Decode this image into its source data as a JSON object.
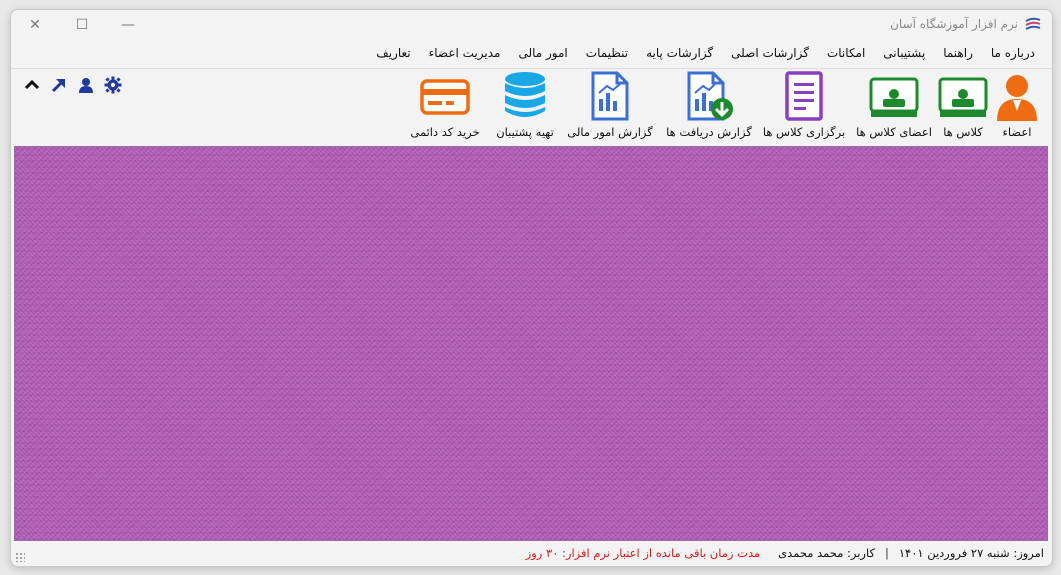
{
  "window": {
    "title": "نرم افزار آموزشگاه آسان",
    "controls": {
      "minimize": "—",
      "maximize": "☐",
      "close": "✕"
    }
  },
  "menu": {
    "items": [
      "تعاریف",
      "مدیریت اعضاء",
      "امور مالی",
      "تنظیمات",
      "گزارشات پایه",
      "گزارشات اصلی",
      "امکانات",
      "پشتیبانی",
      "راهنما",
      "درباره ما"
    ]
  },
  "quick_icons": [
    "settings-gear-icon",
    "user-icon",
    "arrow-up-right-icon",
    "chevron-up-icon"
  ],
  "toolbar": {
    "items": [
      {
        "label": "اعضاء",
        "icon": "member-avatar-icon"
      },
      {
        "label": "کلاس ها",
        "icon": "class-board-icon"
      },
      {
        "label": "اعضای کلاس ها",
        "icon": "class-members-board-icon"
      },
      {
        "label": "برگزاری کلاس ها",
        "icon": "document-list-icon"
      },
      {
        "label": "گزارش دریافت ها",
        "icon": "report-download-icon"
      },
      {
        "label": "گزارش امور مالی",
        "icon": "finance-report-icon"
      },
      {
        "label": "تهیه پشتیبان",
        "icon": "database-icon"
      },
      {
        "label": "خرید کد دائمی",
        "icon": "credit-card-icon"
      }
    ]
  },
  "status": {
    "today": "امروز: شنبه ۲۷ فروردین ۱۴۰۱",
    "separator": "|",
    "user": "کاربر: محمد محمدی",
    "remaining": "مدت زمان باقی مانده از اعتبار نرم افزار: ۳۰ روز"
  },
  "colors": {
    "desktop_texture": "#b25fb8",
    "green_icon": "#1e8a2e",
    "orange_icon": "#ef6c12",
    "purple_icon": "#8a3fbf",
    "blue_icon": "#3b6fd4",
    "cyan_icon": "#1aa7e6",
    "warning_text": "#d21b1b",
    "quick_icon": "#1f3a9e"
  }
}
